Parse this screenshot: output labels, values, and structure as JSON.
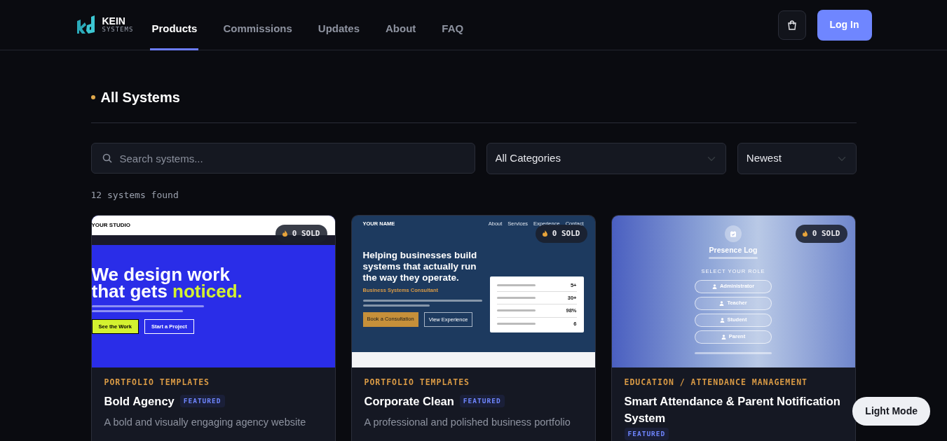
{
  "nav": {
    "brand": "KEIN",
    "brand_sub": "SYSTEMS",
    "links": [
      {
        "label": "Products",
        "selected": true
      },
      {
        "label": "Commissions",
        "selected": false
      },
      {
        "label": "Updates",
        "selected": false
      },
      {
        "label": "About",
        "selected": false
      },
      {
        "label": "FAQ",
        "selected": false
      }
    ],
    "login": "Log In"
  },
  "section_title": "All Systems",
  "filters": {
    "search_placeholder": "Search systems...",
    "category": "All Categories",
    "sort": "Newest"
  },
  "result_count": "12 systems found",
  "products": [
    {
      "category": "PORTFOLIO TEMPLATES",
      "name": "Bold Agency",
      "featured": true,
      "featured_label": "FEATURED",
      "description": "A bold and visually engaging agency website",
      "sold": "0 SOLD",
      "preview": {
        "kind": "studio",
        "brand": "YOUR STUDIO",
        "headline_1": "We design work",
        "headline_2": "that gets",
        "highlight": "noticed.",
        "buttons": [
          "See the Work",
          "Start a Project"
        ]
      }
    },
    {
      "category": "PORTFOLIO TEMPLATES",
      "name": "Corporate Clean",
      "featured": true,
      "featured_label": "FEATURED",
      "description": "A professional and polished business portfolio",
      "sold": "0 SOLD",
      "preview": {
        "kind": "corporate",
        "brand": "YOUR NAME",
        "nav": [
          "About",
          "Services",
          "Experience",
          "Contact"
        ],
        "headline": "Helping businesses build systems that actually run the way they operate.",
        "subtitle": "Business Systems Consultant",
        "buttons": [
          "Book a Consultation",
          "View Experience"
        ],
        "stats": [
          "5+",
          "30+",
          "98%",
          "6"
        ]
      }
    },
    {
      "category": "EDUCATION / ATTENDANCE MANAGEMENT",
      "name": "Smart Attendance & Parent Notification System",
      "featured": true,
      "featured_label": "FEATURED",
      "sold": "0 SOLD",
      "preview": {
        "kind": "presence",
        "title": "Presence Log",
        "role_label": "SELECT YOUR ROLE",
        "roles": [
          "Administrator",
          "Teacher",
          "Student",
          "Parent"
        ]
      }
    }
  ],
  "theme_toggle": "Light Mode"
}
